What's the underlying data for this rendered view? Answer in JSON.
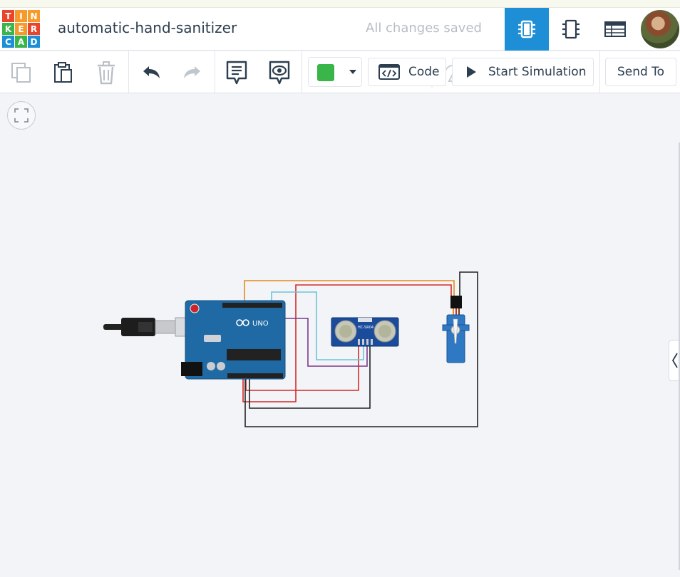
{
  "app": {
    "logo_letters": [
      "T",
      "I",
      "N",
      "K",
      "E",
      "R",
      "C",
      "A",
      "D"
    ],
    "logo_colors": [
      "#e8452c",
      "#f69a2b",
      "#f69a2b",
      "#3ab54a",
      "#f69a2b",
      "#e8452c",
      "#1e8fd6",
      "#3ab54a",
      "#1e8fd6"
    ],
    "project_title": "automatic-hand-sanitizer",
    "save_status": "All changes saved",
    "accent": "#1e8fd6"
  },
  "views": [
    {
      "icon": "circuit-view-icon",
      "active": true
    },
    {
      "icon": "schematic-view-icon",
      "active": false
    },
    {
      "icon": "component-list-icon",
      "active": false
    }
  ],
  "toolbar": {
    "copy_icon": "copy-icon",
    "paste_icon": "paste-icon",
    "delete_icon": "trash-icon",
    "undo_icon": "undo-icon",
    "redo_icon": "redo-icon",
    "notes_icon": "notes-icon",
    "visibility_icon": "eye-icon",
    "wire_color": "#3ab54a",
    "code_label": "Code",
    "start_sim_label": "Start Simulation",
    "send_to_label": "Send To"
  },
  "canvas": {
    "fit_icon": "zoom-to-fit-icon",
    "side_panel_icon": "chevron-left-icon",
    "components": [
      {
        "name": "arduino-uno",
        "text": "UNO"
      },
      {
        "name": "ultrasonic-sensor",
        "text": "HC-SR04"
      },
      {
        "name": "micro-servo"
      }
    ],
    "wire_colors": {
      "orange": "#e88a1a",
      "cyan": "#6cc4d8",
      "red": "#d42a2a",
      "purple": "#7a3a8a",
      "black": "#222222"
    }
  }
}
